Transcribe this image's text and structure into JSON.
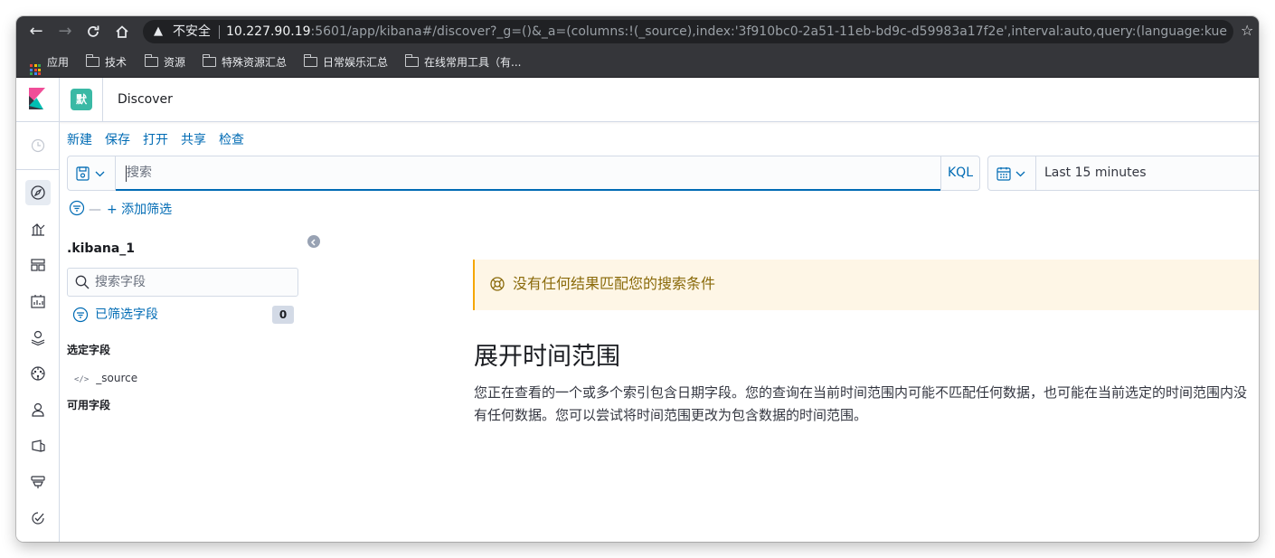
{
  "browser": {
    "security_label": "不安全",
    "url_host": "10.227.90.19",
    "url_rest": ":5601/app/kibana#/discover?_g=()&_a=(columns:!(_source),index:'3f910bc0-2a51-11eb-bd9c-d59983a17f2e',interval:auto,query:(language:kuery,query:'...",
    "bookmarks": [
      "应用",
      "技术",
      "资源",
      "特殊资源汇总",
      "日常娱乐汇总",
      "在线常用工具（有..."
    ]
  },
  "header": {
    "space_initial": "默",
    "breadcrumb": "Discover"
  },
  "top_menu": [
    "新建",
    "保存",
    "打开",
    "共享",
    "检查"
  ],
  "search": {
    "placeholder": "搜索",
    "language": "KQL",
    "time_range": "Last 15 minutes"
  },
  "filter": {
    "add_label": "+ 添加筛选"
  },
  "sidebar": {
    "index_pattern": ".kibana_1",
    "field_search_placeholder": "搜索字段",
    "selected_fields_filter": "已筛选字段",
    "selected_fields_count": "0",
    "selected_section": "选定字段",
    "selected_fields": [
      {
        "type": "</>",
        "name": "_source"
      }
    ],
    "available_section": "可用字段"
  },
  "results": {
    "no_results": "没有任何结果匹配您的搜索条件",
    "expand_title": "展开时间范围",
    "expand_body": "您正在查看的一个或多个索引包含日期字段。您的查询在当前时间范围内可能不匹配任何数据，也可能在当前选定的时间范围内没有任何数据。您可以尝试将时间范围更改为包含数据的时间范围。"
  },
  "icons": {
    "rail": [
      "clock-icon",
      "discover-icon",
      "visualize-icon",
      "dashboard-icon",
      "canvas-icon",
      "maps-icon",
      "ml-icon",
      "users-icon",
      "apm-icon",
      "uptime-icon",
      "monitoring-icon"
    ]
  },
  "colors": {
    "link": "#006bb4",
    "callout_bg": "#fef6e6",
    "callout_border": "#f5a700",
    "space_badge": "#3ab9a5",
    "chrome_dark": "#35363a"
  }
}
